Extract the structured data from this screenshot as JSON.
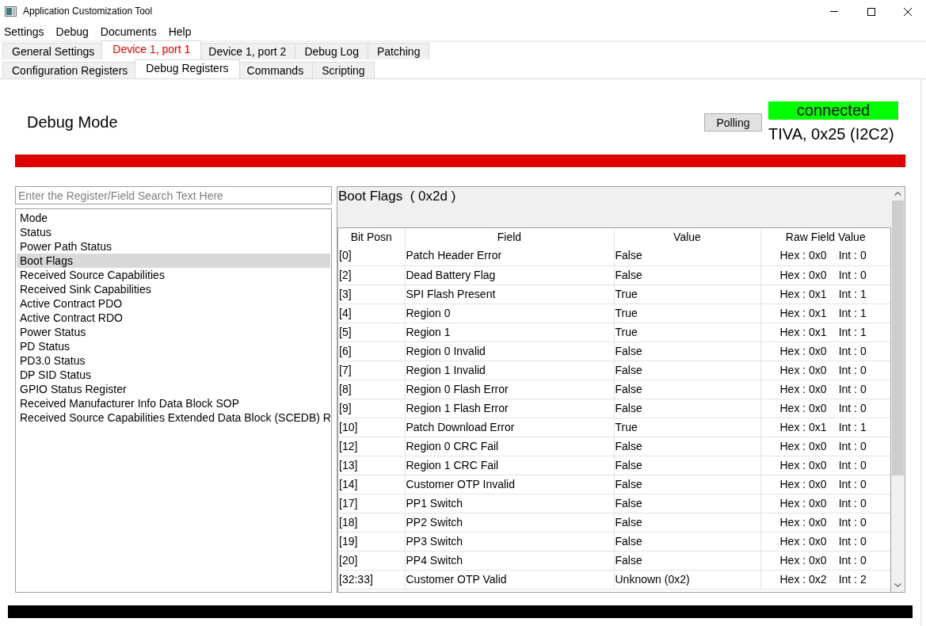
{
  "window": {
    "title": "Application Customization Tool"
  },
  "menu": [
    "Settings",
    "Debug",
    "Documents",
    "Help"
  ],
  "tabs": [
    {
      "label": "General Settings",
      "selected": false
    },
    {
      "label": "Device 1, port 1",
      "selected": true
    },
    {
      "label": "Device 1, port 2",
      "selected": false
    },
    {
      "label": "Debug Log",
      "selected": false
    },
    {
      "label": "Patching",
      "selected": false
    }
  ],
  "subtabs": [
    {
      "label": "Configuration Registers",
      "selected": false
    },
    {
      "label": "Debug Registers",
      "selected": true
    },
    {
      "label": "Commands",
      "selected": false
    },
    {
      "label": "Scripting",
      "selected": false
    }
  ],
  "header": {
    "heading": "Debug Mode",
    "polling_button": "Polling",
    "connection": {
      "label": "connected",
      "connected": true
    },
    "device": "TIVA, 0x25 (I2C2)"
  },
  "search": {
    "placeholder": "Enter the Register/Field Search Text Here"
  },
  "registers": [
    {
      "label": "Mode",
      "selected": false
    },
    {
      "label": "Status",
      "selected": false
    },
    {
      "label": "Power Path Status",
      "selected": false
    },
    {
      "label": "Boot Flags",
      "selected": true
    },
    {
      "label": "Received Source Capabilities",
      "selected": false
    },
    {
      "label": "Received Sink Capabilities",
      "selected": false
    },
    {
      "label": "Active Contract PDO",
      "selected": false
    },
    {
      "label": "Active Contract RDO",
      "selected": false
    },
    {
      "label": "Power Status",
      "selected": false
    },
    {
      "label": "PD Status",
      "selected": false
    },
    {
      "label": "PD3.0 Status",
      "selected": false
    },
    {
      "label": "DP SID Status",
      "selected": false
    },
    {
      "label": "GPIO Status Register",
      "selected": false
    },
    {
      "label": "Received Manufacturer Info Data Block SOP",
      "selected": false
    },
    {
      "label": "Received Source Capabilities Extended Data Block (SCEDB) R",
      "selected": false
    }
  ],
  "register_view": {
    "title": "Boot Flags  ( 0x2d )",
    "columns": [
      "Bit Posn",
      "Field",
      "Value",
      "Raw Field Value"
    ],
    "rows": [
      {
        "bit": "[0]",
        "field": "Patch Header Error",
        "value": "False",
        "hex": "Hex : 0x0",
        "int": "Int : 0"
      },
      {
        "bit": "[2]",
        "field": "Dead Battery Flag",
        "value": "False",
        "hex": "Hex : 0x0",
        "int": "Int : 0"
      },
      {
        "bit": "[3]",
        "field": "SPI Flash Present",
        "value": "True",
        "hex": "Hex : 0x1",
        "int": "Int : 1"
      },
      {
        "bit": "[4]",
        "field": "Region 0",
        "value": "True",
        "hex": "Hex : 0x1",
        "int": "Int : 1"
      },
      {
        "bit": "[5]",
        "field": "Region 1",
        "value": "True",
        "hex": "Hex : 0x1",
        "int": "Int : 1"
      },
      {
        "bit": "[6]",
        "field": "Region 0 Invalid",
        "value": "False",
        "hex": "Hex : 0x0",
        "int": "Int : 0"
      },
      {
        "bit": "[7]",
        "field": "Region 1 Invalid",
        "value": "False",
        "hex": "Hex : 0x0",
        "int": "Int : 0"
      },
      {
        "bit": "[8]",
        "field": "Region 0 Flash Error",
        "value": "False",
        "hex": "Hex : 0x0",
        "int": "Int : 0"
      },
      {
        "bit": "[9]",
        "field": "Region 1 Flash Error",
        "value": "False",
        "hex": "Hex : 0x0",
        "int": "Int : 0"
      },
      {
        "bit": "[10]",
        "field": "Patch Download Error",
        "value": "True",
        "hex": "Hex : 0x1",
        "int": "Int : 1"
      },
      {
        "bit": "[12]",
        "field": "Region 0 CRC Fail",
        "value": "False",
        "hex": "Hex : 0x0",
        "int": "Int : 0"
      },
      {
        "bit": "[13]",
        "field": "Region 1 CRC Fail",
        "value": "False",
        "hex": "Hex : 0x0",
        "int": "Int : 0"
      },
      {
        "bit": "[14]",
        "field": "Customer OTP Invalid",
        "value": "False",
        "hex": "Hex : 0x0",
        "int": "Int : 0"
      },
      {
        "bit": "[17]",
        "field": "PP1 Switch",
        "value": "False",
        "hex": "Hex : 0x0",
        "int": "Int : 0"
      },
      {
        "bit": "[18]",
        "field": "PP2 Switch",
        "value": "False",
        "hex": "Hex : 0x0",
        "int": "Int : 0"
      },
      {
        "bit": "[19]",
        "field": "PP3 Switch",
        "value": "False",
        "hex": "Hex : 0x0",
        "int": "Int : 0"
      },
      {
        "bit": "[20]",
        "field": "PP4 Switch",
        "value": "False",
        "hex": "Hex : 0x0",
        "int": "Int : 0"
      },
      {
        "bit": "[32:33]",
        "field": "Customer OTP Valid",
        "value": "Unknown (0x2)",
        "hex": "Hex : 0x2",
        "int": "Int : 2"
      }
    ]
  }
}
